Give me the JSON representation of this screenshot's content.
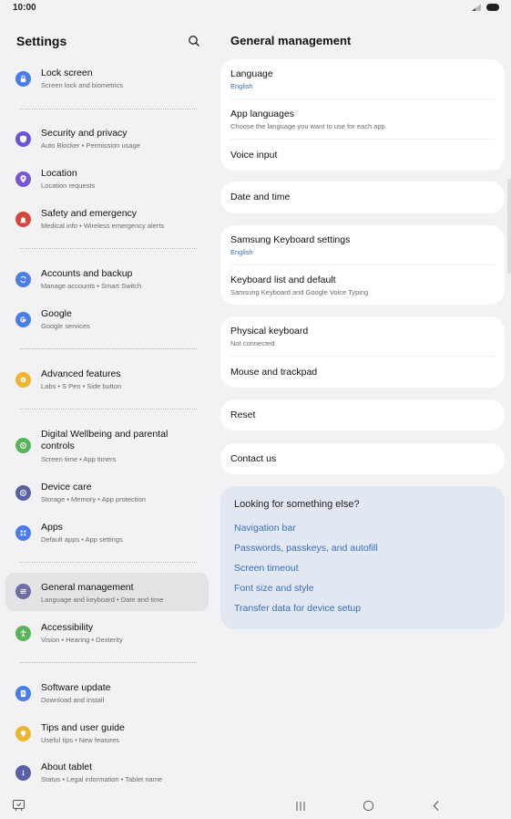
{
  "status": {
    "time": "10:00"
  },
  "left": {
    "title": "Settings",
    "items": [
      {
        "title": "Lock screen",
        "subtitle": "Screen lock and biometrics",
        "icon": "lock-icon",
        "color": "#4b7de8"
      },
      {
        "title": "Security and privacy",
        "subtitle": "Auto Blocker  •  Permission usage",
        "icon": "shield-icon",
        "color": "#6a54d6"
      },
      {
        "title": "Location",
        "subtitle": "Location requests",
        "icon": "location-pin-icon",
        "color": "#7a56d6"
      },
      {
        "title": "Safety and emergency",
        "subtitle": "Medical info  •  Wireless emergency alerts",
        "icon": "alert-icon",
        "color": "#d4473c"
      },
      {
        "title": "Accounts and backup",
        "subtitle": "Manage accounts  •  Smart Switch",
        "icon": "sync-icon",
        "color": "#4b7de8"
      },
      {
        "title": "Google",
        "subtitle": "Google services",
        "icon": "google-icon",
        "color": "#4b7de8"
      },
      {
        "title": "Advanced features",
        "subtitle": "Labs  •  S Pen  •  Side button",
        "icon": "gear-plus-icon",
        "color": "#f0b433"
      },
      {
        "title": "Digital Wellbeing and parental controls",
        "subtitle": "Screen time  •  App timers",
        "icon": "wellbeing-icon",
        "color": "#57b45a"
      },
      {
        "title": "Device care",
        "subtitle": "Storage  •  Memory  •  App protection",
        "icon": "device-care-icon",
        "color": "#5a5fa8"
      },
      {
        "title": "Apps",
        "subtitle": "Default apps  •  App settings",
        "icon": "apps-grid-icon",
        "color": "#4b7de8"
      },
      {
        "title": "General management",
        "subtitle": "Language and keyboard  •  Date and time",
        "icon": "sliders-icon",
        "color": "#6a6fa4"
      },
      {
        "title": "Accessibility",
        "subtitle": "Vision  •  Hearing  •  Dexterity",
        "icon": "accessibility-icon",
        "color": "#57b45a"
      },
      {
        "title": "Software update",
        "subtitle": "Download and install",
        "icon": "update-icon",
        "color": "#4b7de8"
      },
      {
        "title": "Tips and user guide",
        "subtitle": "Useful tips  •  New features",
        "icon": "lightbulb-icon",
        "color": "#f0b433"
      },
      {
        "title": "About tablet",
        "subtitle": "Status  •  Legal information  •  Tablet name",
        "icon": "info-icon",
        "color": "#5a5fa8"
      }
    ]
  },
  "right": {
    "title": "General management",
    "cards": [
      [
        {
          "title": "Language",
          "subtitle": "English",
          "sub_style": "blue"
        },
        {
          "title": "App languages",
          "subtitle": "Choose the language you want to use for each app.",
          "sub_style": "gray"
        },
        {
          "title": "Voice input"
        }
      ],
      [
        {
          "title": "Date and time"
        }
      ],
      [
        {
          "title": "Samsung Keyboard settings",
          "subtitle": "English",
          "sub_style": "blue"
        },
        {
          "title": "Keyboard list and default",
          "subtitle": "Samsung Keyboard and Google Voice Typing",
          "sub_style": "gray"
        }
      ],
      [
        {
          "title": "Physical keyboard",
          "subtitle": "Not connected",
          "sub_style": "gray"
        },
        {
          "title": "Mouse and trackpad"
        }
      ],
      [
        {
          "title": "Reset"
        }
      ],
      [
        {
          "title": "Contact us"
        }
      ]
    ],
    "suggestions": {
      "title": "Looking for something else?",
      "links": [
        "Navigation bar",
        "Passwords, passkeys, and autofill",
        "Screen timeout",
        "Font size and style",
        "Transfer data for device setup"
      ]
    }
  },
  "colors": {
    "accent_link": "#3a6cc0",
    "active_item_bg": "#e3e3e6",
    "background": "#f2f2f4"
  }
}
